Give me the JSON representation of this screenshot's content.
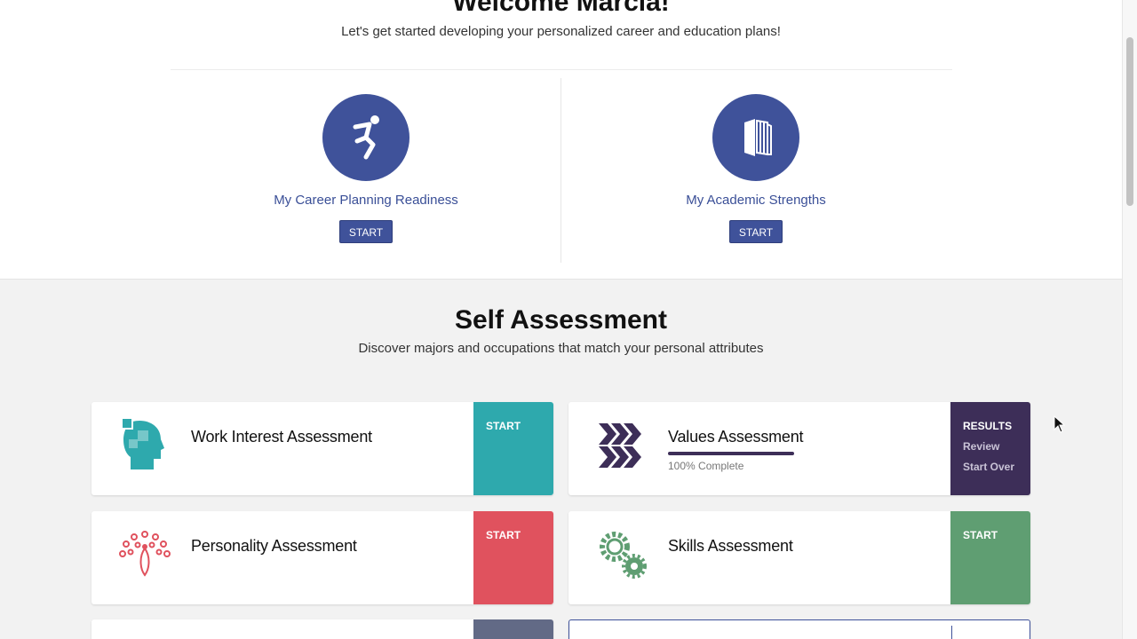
{
  "welcome": {
    "title": "Welcome Marcia!",
    "subtitle": "Let's get started developing your personalized career and education plans!"
  },
  "readiness": [
    {
      "label": "My Career Planning Readiness",
      "button": "START",
      "icon": "runner-icon"
    },
    {
      "label": "My Academic Strengths",
      "button": "START",
      "icon": "book-icon"
    }
  ],
  "self_assessment": {
    "title": "Self Assessment",
    "subtitle": "Discover majors and occupations that match your personal attributes",
    "cards": [
      {
        "name": "Work Interest Assessment",
        "action": "START",
        "color": "#2ea9ad",
        "icon": "puzzle-head-icon"
      },
      {
        "name": "Values Assessment",
        "action": "RESULTS",
        "review": "Review",
        "start_over": "Start Over",
        "progress_text": "100% Complete",
        "progress": 1.0,
        "color": "#3d2e58",
        "icon": "chevron-pattern-icon"
      },
      {
        "name": "Personality Assessment",
        "action": "START",
        "color": "#e0525e",
        "icon": "peacock-icon"
      },
      {
        "name": "Skills Assessment",
        "action": "START",
        "color": "#5f9e72",
        "icon": "gears-icon"
      }
    ]
  },
  "colors": {
    "primary": "#3f529a",
    "background": "#f2f2f2"
  }
}
